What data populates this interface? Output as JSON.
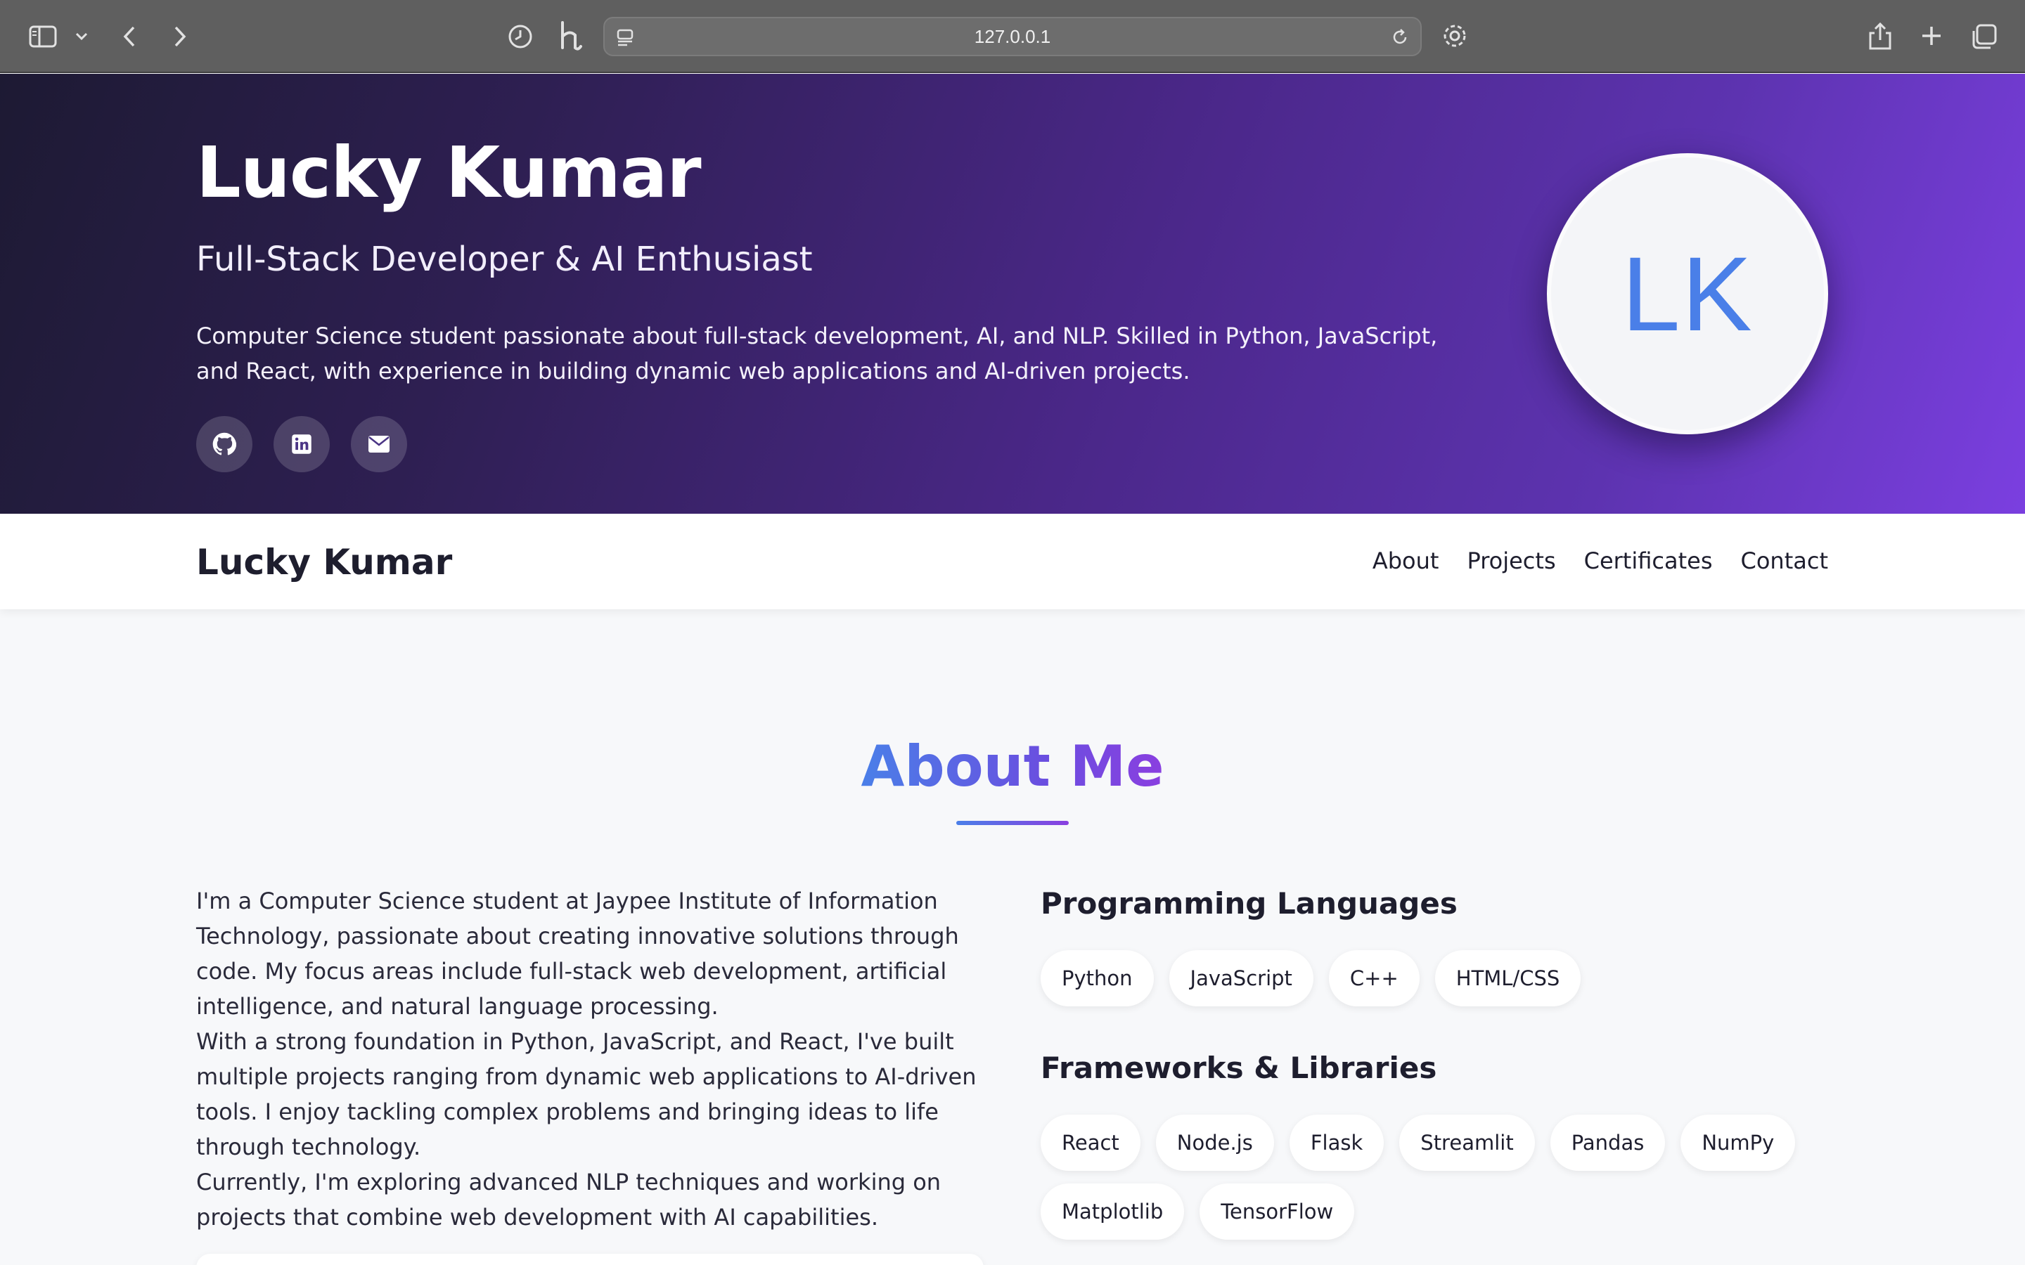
{
  "browser": {
    "url": "127.0.0.1",
    "icons": [
      "sidebar-icon",
      "chevron-down-icon",
      "back-icon",
      "forward-icon",
      "history-icon",
      "extension-h-icon",
      "page-menu-icon",
      "reload-icon",
      "settings-gear-icon",
      "share-icon",
      "new-tab-icon",
      "tabs-overview-icon"
    ]
  },
  "hero": {
    "name": "Lucky Kumar",
    "subtitle": "Full-Stack Developer & AI Enthusiast",
    "description": "Computer Science student passionate about full-stack development, AI, and NLP. Skilled in Python, JavaScript, and React, with experience in building dynamic web applications and AI-driven projects.",
    "social": [
      "github-icon",
      "linkedin-icon",
      "email-icon"
    ],
    "avatar_initials": "LK"
  },
  "nav": {
    "brand": "Lucky Kumar",
    "links": [
      "About",
      "Projects",
      "Certificates",
      "Contact"
    ]
  },
  "about": {
    "title": "About Me",
    "paragraphs": [
      "I'm a Computer Science student at Jaypee Institute of Information Technology, passionate about creating innovative solutions through code. My focus areas include full-stack web development, artificial intelligence, and natural language processing.",
      "With a strong foundation in Python, JavaScript, and React, I've built multiple projects ranging from dynamic web applications to AI-driven tools. I enjoy tackling complex problems and bringing ideas to life through technology.",
      "Currently, I'm exploring advanced NLP techniques and working on projects that combine web development with AI capabilities."
    ],
    "skills": [
      {
        "heading": "Programming Languages",
        "items": [
          "Python",
          "JavaScript",
          "C++",
          "HTML/CSS"
        ]
      },
      {
        "heading": "Frameworks & Libraries",
        "items": [
          "React",
          "Node.js",
          "Flask",
          "Streamlit",
          "Pandas",
          "NumPy",
          "Matplotlib",
          "TensorFlow"
        ]
      }
    ]
  },
  "colors": {
    "hero_gradient_start": "#1d1a33",
    "hero_gradient_end": "#7b3fe0",
    "accent_blue": "#4a7fe8",
    "accent_purple": "#8a3fe0"
  }
}
